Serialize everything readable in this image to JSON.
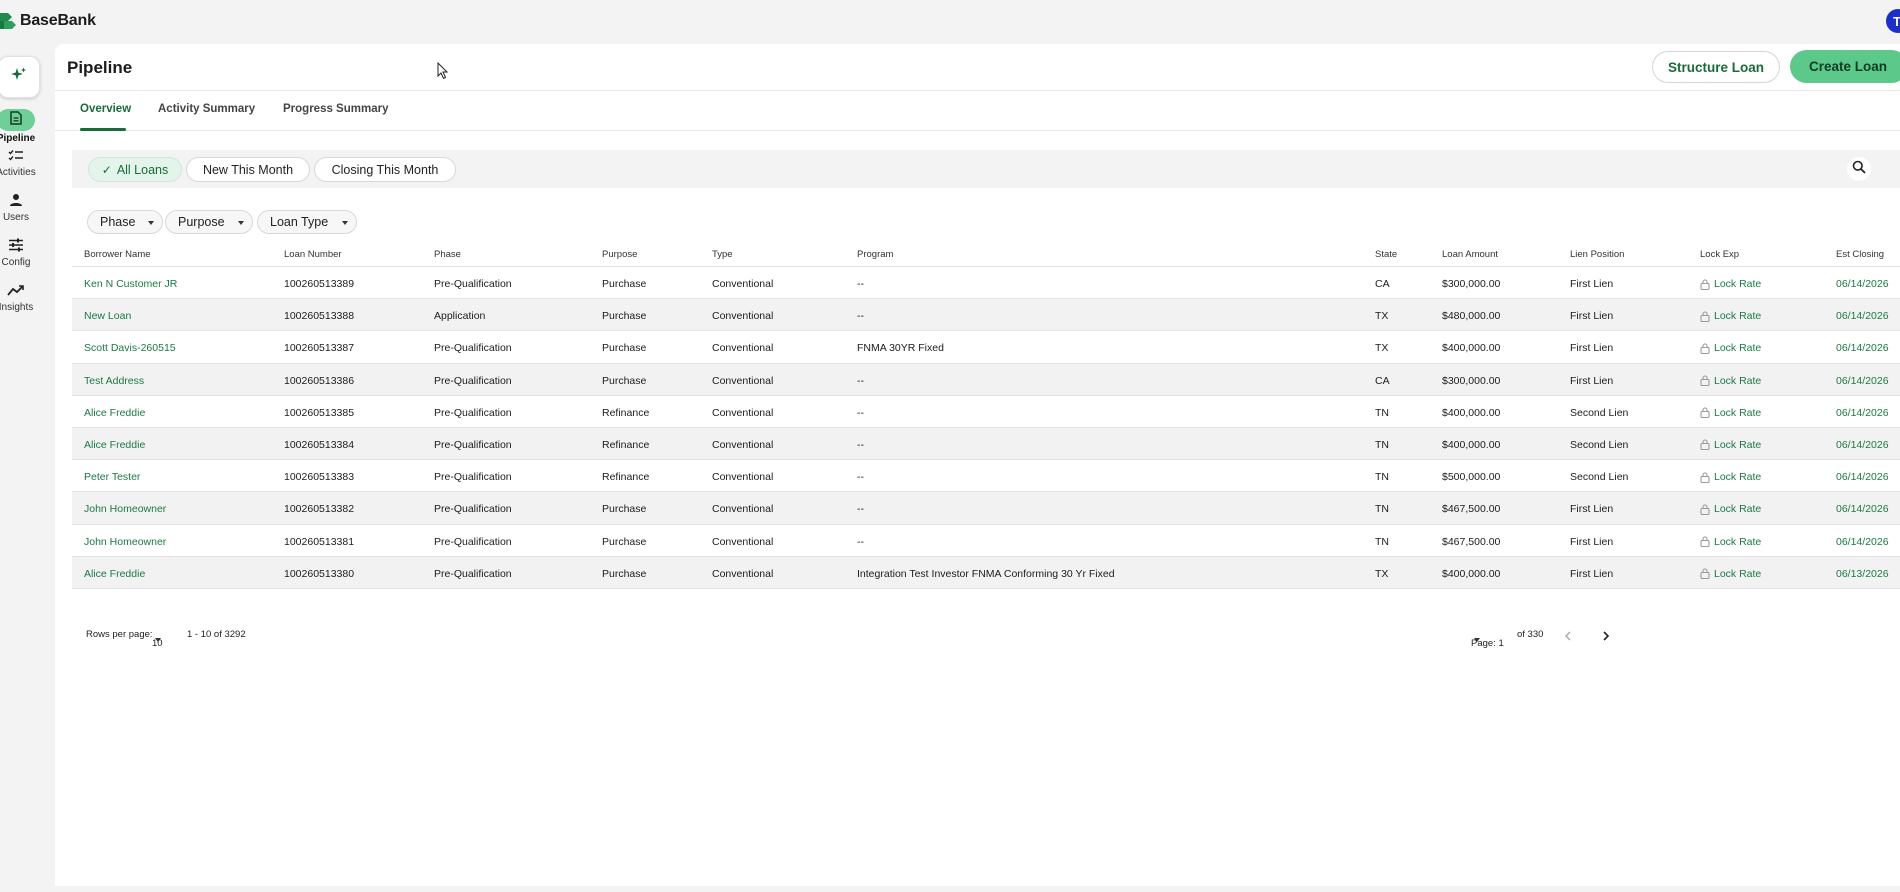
{
  "app": {
    "brand": "BaseBank",
    "avatar_initial": "T"
  },
  "rail": {
    "items": [
      {
        "label": "Pipeline",
        "icon": "document-icon",
        "active": true
      },
      {
        "label": "Activities",
        "icon": "checklist-icon",
        "active": false
      },
      {
        "label": "Users",
        "icon": "user-icon",
        "active": false
      },
      {
        "label": "Config",
        "icon": "sliders-icon",
        "active": false
      },
      {
        "label": "Insights",
        "icon": "trend-icon",
        "active": false
      }
    ]
  },
  "header": {
    "title": "Pipeline",
    "structure_label": "Structure Loan",
    "create_label": "Create Loan"
  },
  "tabs": [
    {
      "label": "Overview",
      "active": true
    },
    {
      "label": "Activity Summary",
      "active": false
    },
    {
      "label": "Progress Summary",
      "active": false
    }
  ],
  "quick_filters": [
    {
      "label": "All Loans",
      "selected": true
    },
    {
      "label": "New This Month",
      "selected": false
    },
    {
      "label": "Closing This Month",
      "selected": false
    }
  ],
  "dropdowns": [
    {
      "label": "Phase"
    },
    {
      "label": "Purpose"
    },
    {
      "label": "Loan Type"
    }
  ],
  "table": {
    "columns": [
      "Borrower Name",
      "Loan Number",
      "Phase",
      "Purpose",
      "Type",
      "Program",
      "State",
      "Loan Amount",
      "Lien Position",
      "Lock Exp",
      "Est Closing"
    ],
    "rows": [
      [
        "Ken N Customer JR",
        "100260513389",
        "Pre-Qualification",
        "Purchase",
        "Conventional",
        "--",
        "CA",
        "$300,000.00",
        "First Lien",
        "Lock Rate",
        "06/14/2026"
      ],
      [
        "New Loan",
        "100260513388",
        "Application",
        "Purchase",
        "Conventional",
        "--",
        "TX",
        "$480,000.00",
        "First Lien",
        "Lock Rate",
        "06/14/2026"
      ],
      [
        "Scott Davis-260515",
        "100260513387",
        "Pre-Qualification",
        "Purchase",
        "Conventional",
        "FNMA 30YR Fixed",
        "TX",
        "$400,000.00",
        "First Lien",
        "Lock Rate",
        "06/14/2026"
      ],
      [
        "Test Address",
        "100260513386",
        "Pre-Qualification",
        "Purchase",
        "Conventional",
        "--",
        "CA",
        "$300,000.00",
        "First Lien",
        "Lock Rate",
        "06/14/2026"
      ],
      [
        "Alice Freddie",
        "100260513385",
        "Pre-Qualification",
        "Refinance",
        "Conventional",
        "--",
        "TN",
        "$400,000.00",
        "Second Lien",
        "Lock Rate",
        "06/14/2026"
      ],
      [
        "Alice Freddie",
        "100260513384",
        "Pre-Qualification",
        "Refinance",
        "Conventional",
        "--",
        "TN",
        "$400,000.00",
        "Second Lien",
        "Lock Rate",
        "06/14/2026"
      ],
      [
        "Peter Tester",
        "100260513383",
        "Pre-Qualification",
        "Refinance",
        "Conventional",
        "--",
        "TN",
        "$500,000.00",
        "Second Lien",
        "Lock Rate",
        "06/14/2026"
      ],
      [
        "John Homeowner",
        "100260513382",
        "Pre-Qualification",
        "Purchase",
        "Conventional",
        "--",
        "TN",
        "$467,500.00",
        "First Lien",
        "Lock Rate",
        "06/14/2026"
      ],
      [
        "John Homeowner",
        "100260513381",
        "Pre-Qualification",
        "Purchase",
        "Conventional",
        "--",
        "TN",
        "$467,500.00",
        "First Lien",
        "Lock Rate",
        "06/14/2026"
      ],
      [
        "Alice Freddie",
        "100260513380",
        "Pre-Qualification",
        "Purchase",
        "Conventional",
        "Integration Test Investor FNMA Conforming 30 Yr Fixed",
        "TX",
        "$400,000.00",
        "First Lien",
        "Lock Rate",
        "06/13/2026"
      ]
    ]
  },
  "pagination": {
    "rows_per_page_label": "Rows per page:",
    "rows_per_page": "10",
    "range": "1 - 10 of 3292",
    "page_label": "Page: 1",
    "of_pages": "of 330"
  },
  "colors": {
    "accent": "#1a7a42",
    "create_button": "#5cc98a",
    "selected_chip": "#e3f4ea",
    "avatar": "#1c2fc9"
  }
}
